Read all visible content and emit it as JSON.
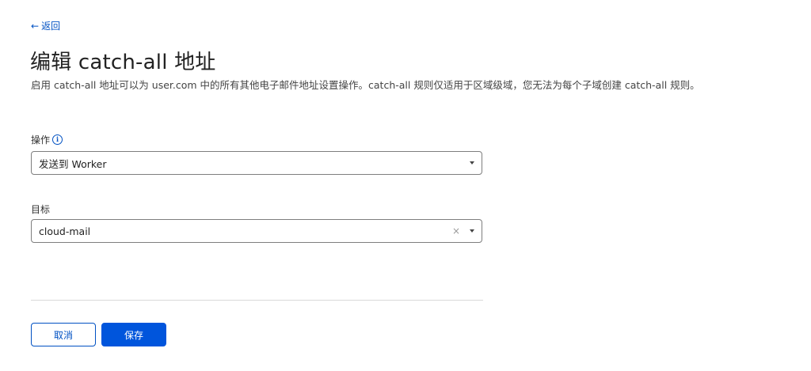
{
  "nav": {
    "back_arrow": "←",
    "back_label": "返回"
  },
  "page": {
    "title": "编辑 catch-all 地址",
    "description": "启用 catch-all 地址可以为 user.com 中的所有其他电子邮件地址设置操作。catch-all 规则仅适用于区域级域，您无法为每个子域创建 catch-all 规则。"
  },
  "form": {
    "action": {
      "label": "操作",
      "info_icon": "i",
      "selected": "发送到 Worker"
    },
    "target": {
      "label": "目标",
      "selected": "cloud-mail",
      "clear_glyph": "×"
    }
  },
  "buttons": {
    "cancel_label": "取消",
    "save_label": "保存"
  },
  "colors": {
    "link": "#0051c3",
    "primary": "#0055dc",
    "border": "#7e7e7e",
    "divider": "#d9d9d9"
  }
}
